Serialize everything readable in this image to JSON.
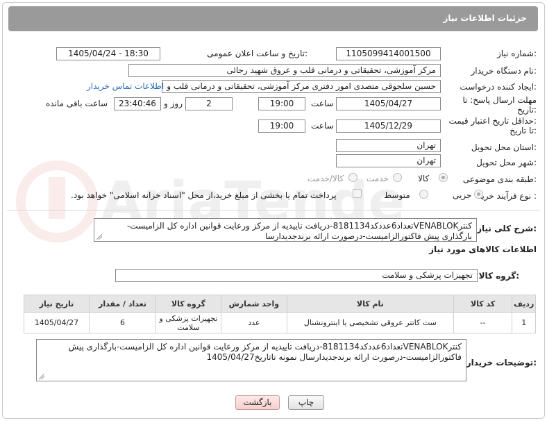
{
  "header": {
    "title": "جزئیات اطلاعات نیاز"
  },
  "form": {
    "need_number": {
      "label": "شماره نیاز:",
      "value": "1105099414001500"
    },
    "announce": {
      "label": "تاریخ و ساعت اعلان عمومی:",
      "value": "1405/04/24 - 18:30"
    },
    "buyer_org": {
      "label": "نام دستگاه خریدار:",
      "value": "مرکز آموزشی، تحقیقاتی و درمانی قلب و عروق شهید رجائی"
    },
    "creator": {
      "label": "ایجاد کننده درخواست:",
      "value": "حسین سلجوقی متصدی امور دفتری مرکز آموزشی، تحقیقاتی و درمانی قلب و :",
      "contact_link": "اطلاعات تماس خریدار"
    },
    "reply_deadline": {
      "label_line1": "مهلت ارسال پاسخ: تا",
      "label_line2": "تاریخ:",
      "date": "1405/04/27",
      "time_label": "ساعت",
      "time": "19:00",
      "days": "2",
      "days_label": "روز و",
      "remaining": "23:40:46",
      "remaining_label": "ساعت باقی مانده"
    },
    "price_validity": {
      "label_line1": "حداقل تاریخ اعتبار قیمت:",
      "label_line2": "تا تاریخ:",
      "date": "1405/12/29",
      "time_label": "ساعت",
      "time": "19:00"
    },
    "province": {
      "label": "استان محل تحویل:",
      "value": "تهران"
    },
    "city": {
      "label": "شهر محل تحویل:",
      "value": "تهران"
    },
    "category": {
      "label": "طبقه بندی موضوعی:",
      "options": [
        "کالا",
        "خدمت",
        "کالا/خدمت"
      ],
      "selected": "کالا"
    },
    "process": {
      "label": "نوع فرآیند خرید :",
      "options": [
        "جزیی",
        "متوسط"
      ],
      "selected": "جزیی",
      "payment_note": "پرداخت تمام یا بخشی از مبلغ خرید،از محل \"اسناد خزانه اسلامی\" خواهد بود."
    }
  },
  "summary": {
    "label": "شرح کلی نیاز:",
    "text": "کنترVENABLOKتعداد6عددکد8181134-دریافت تاییدیه از مرکز ورعایت قوانین اداره کل الزامیست-بارگذاری پیش فاکتورالزامیست-درصورت ارائه برندجدیدارسا"
  },
  "goods": {
    "section_title": "اطلاعات کالاهای مورد نیاز",
    "group_label": "گروه کالا:",
    "group_value": "تجهیزات پزشکی و سلامت",
    "columns": [
      "ردیف",
      "کد کالا",
      "نام کالا",
      "واحد شمارش",
      "گروه کالا",
      "تعداد / مقدار",
      "تاریخ نیاز"
    ],
    "rows": [
      {
        "row": "1",
        "code": "--",
        "name": "ست کاتتر عروقی تشخیصی یا اینترونشنال",
        "unit": "عدد",
        "group": "تجهیزات پزشکی و سلامت",
        "qty": "6",
        "date": "1405/04/27"
      }
    ]
  },
  "buyer_notes": {
    "label": "توضیحات خریدار:",
    "text": "کنترVENABLOKتعداد6عددکد8181134-دریافت تاییدیه از مرکز ورعایت قوانین اداره کل الزامیست-بارگذاری پیش فاکتورالزامیست-درصورت ارائه برندجدیدارسال نمونه تاتاریخ1405/04/27"
  },
  "buttons": {
    "print": "چاپ",
    "back": "بازگشت"
  },
  "watermark": {
    "text": "AriaTender.net"
  }
}
